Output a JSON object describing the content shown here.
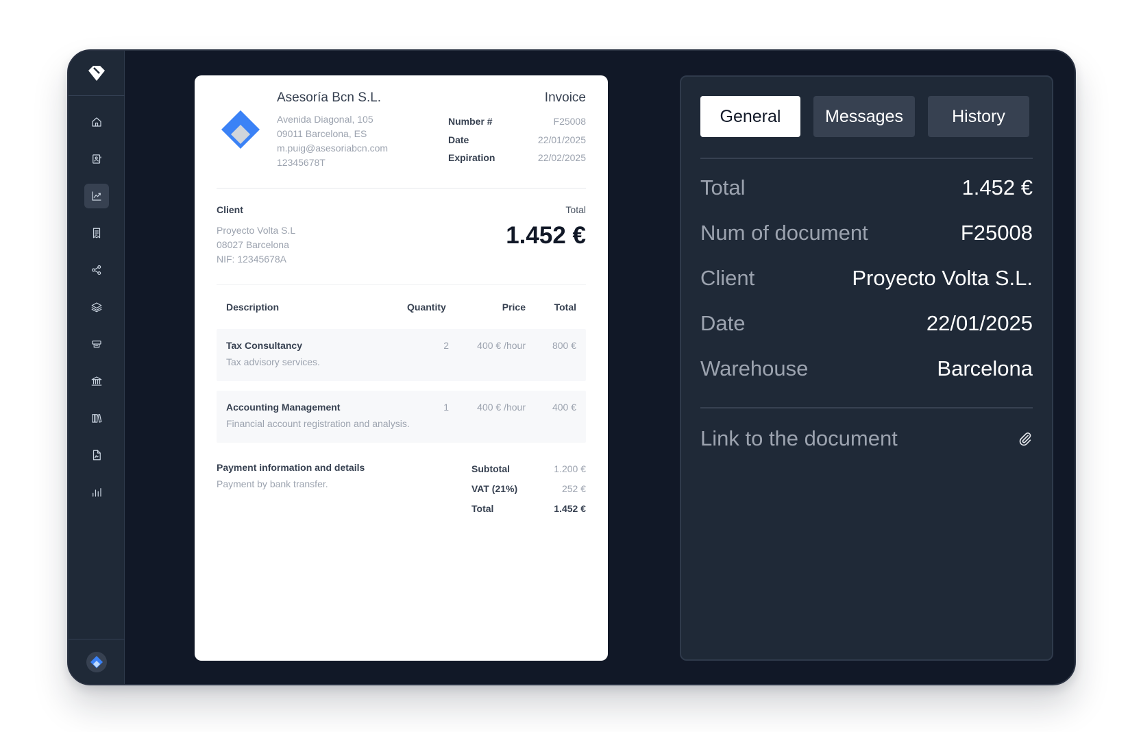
{
  "sidebar": {
    "logo_icon": "app-logo-icon",
    "items": [
      {
        "icon": "home-icon",
        "active": false
      },
      {
        "icon": "contacts-icon",
        "active": false
      },
      {
        "icon": "chart-line-icon",
        "active": true
      },
      {
        "icon": "receipt-icon",
        "active": false
      },
      {
        "icon": "share-icon",
        "active": false
      },
      {
        "icon": "layers-icon",
        "active": false
      },
      {
        "icon": "card-stack-icon",
        "active": false
      },
      {
        "icon": "bank-icon",
        "active": false
      },
      {
        "icon": "library-icon",
        "active": false
      },
      {
        "icon": "document-icon",
        "active": false
      },
      {
        "icon": "bar-chart-icon",
        "active": false
      }
    ],
    "avatar_icon": "company-avatar-icon"
  },
  "invoice": {
    "company": {
      "name": "Asesoría Bcn S.L.",
      "address": "Avenida Diagonal, 105",
      "city": "09011 Barcelona, ES",
      "email": "m.puig@asesoriabcn.com",
      "tax_id": "12345678T"
    },
    "title": "Invoice",
    "meta": {
      "number_label": "Number #",
      "number": "F25008",
      "date_label": "Date",
      "date": "22/01/2025",
      "expiration_label": "Expiration",
      "expiration": "22/02/2025"
    },
    "client": {
      "label": "Client",
      "name": "Proyecto Volta S.L",
      "city": "08027 Barcelona",
      "nif": "NIF: 12345678A"
    },
    "total_label": "Total",
    "total_amount": "1.452 €",
    "table": {
      "headers": {
        "description": "Description",
        "quantity": "Quantity",
        "price": "Price",
        "total": "Total"
      },
      "rows": [
        {
          "name": "Tax Consultancy",
          "desc": "Tax advisory services.",
          "qty": "2",
          "price": "400 € /hour",
          "total": "800 €"
        },
        {
          "name": "Accounting Management",
          "desc": "Financial account registration and analysis.",
          "qty": "1",
          "price": "400 € /hour",
          "total": "400 €"
        }
      ]
    },
    "payment": {
      "title": "Payment information and details",
      "desc": "Payment by bank transfer."
    },
    "summary": {
      "subtotal_label": "Subtotal",
      "subtotal": "1.200 €",
      "vat_label": "VAT (21%)",
      "vat": "252 €",
      "total_label": "Total",
      "total": "1.452 €"
    }
  },
  "panel": {
    "tabs": [
      {
        "label": "General",
        "active": true
      },
      {
        "label": "Messages",
        "active": false
      },
      {
        "label": "History",
        "active": false
      }
    ],
    "details": {
      "total_label": "Total",
      "total": "1.452 €",
      "num_label": "Num of document",
      "num": "F25008",
      "client_label": "Client",
      "client": "Proyecto Volta S.L.",
      "date_label": "Date",
      "date": "22/01/2025",
      "warehouse_label": "Warehouse",
      "warehouse": "Barcelona"
    },
    "link_label": "Link to the document",
    "link_icon": "paperclip-icon"
  },
  "colors": {
    "background": "#111827",
    "sidebar": "#1f2937",
    "panel": "#1f2937",
    "tab_inactive": "#374151",
    "accent": "#3b82f6"
  }
}
